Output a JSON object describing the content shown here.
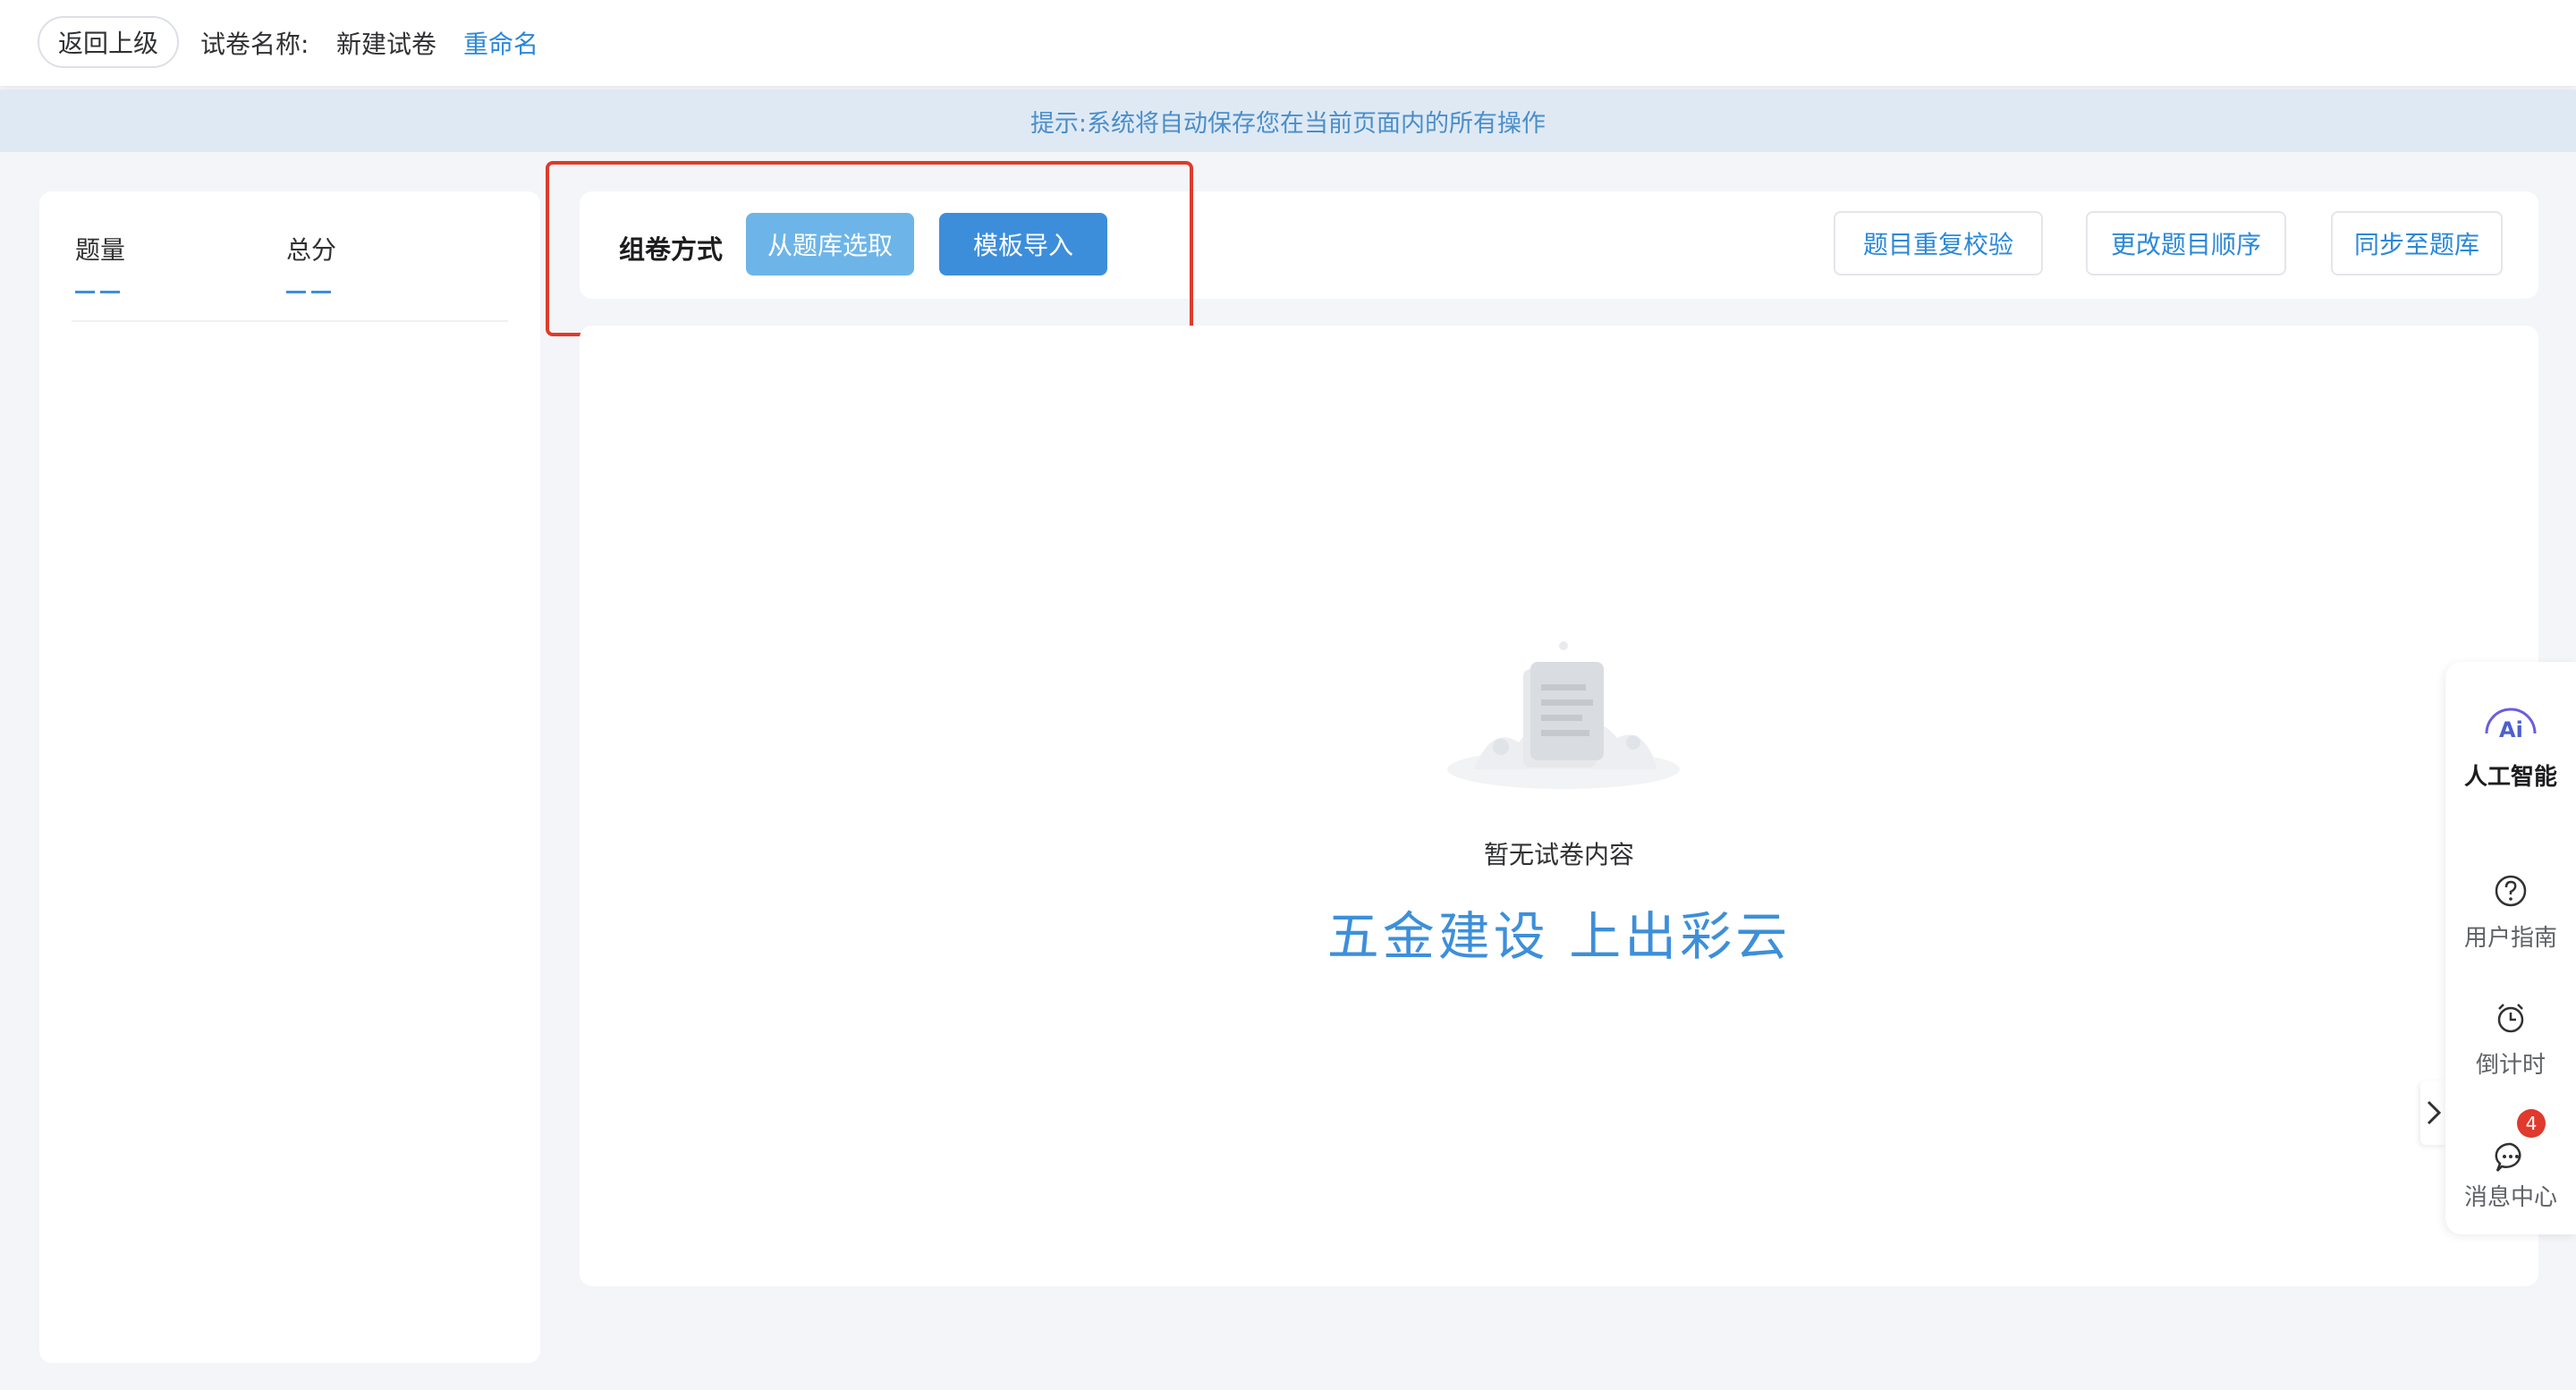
{
  "header": {
    "back_label": "返回上级",
    "paper_name_label": "试卷名称:",
    "paper_name": "新建试卷",
    "rename_label": "重命名"
  },
  "notice": {
    "text": "提示:系统将自动保存您在当前页面内的所有操作"
  },
  "stats": {
    "count_label": "题量",
    "score_label": "总分"
  },
  "toolbar": {
    "mode_label": "组卷方式",
    "from_bank_label": "从题库选取",
    "template_import_label": "模板导入",
    "dup_check_label": "题目重复校验",
    "reorder_label": "更改题目顺序",
    "sync_label": "同步至题库"
  },
  "content": {
    "empty_text": "暂无试卷内容",
    "slogan": "五金建设 上出彩云"
  },
  "side_rail": {
    "ai_label": "人工智能",
    "guide_label": "用户指南",
    "countdown_label": "倒计时",
    "messages_label": "消息中心",
    "messages_badge": "4"
  },
  "colors": {
    "accent": "#3d8fd9",
    "highlight": "#e03a2b",
    "badge": "#e0392d"
  }
}
